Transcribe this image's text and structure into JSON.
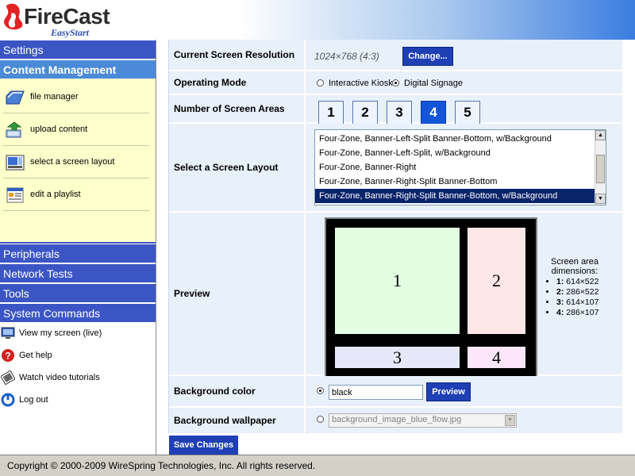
{
  "header": {
    "logo_title": "FireCast",
    "logo_subtitle": "EasyStart"
  },
  "sidebar": {
    "settings": "Settings",
    "content_management": "Content Management",
    "cm_items": [
      "file manager",
      "upload content",
      "select a screen layout",
      "edit a playlist"
    ],
    "peripherals": "Peripherals",
    "network_tests": "Network Tests",
    "tools": "Tools",
    "system_commands": "System Commands",
    "sys_items": [
      "View my screen (live)",
      "Get help",
      "Watch video tutorials",
      "Log out"
    ]
  },
  "form": {
    "resolution": {
      "label": "Current Screen Resolution",
      "value": "1024×768 (4:3)",
      "button": "Change..."
    },
    "mode": {
      "label": "Operating Mode",
      "options": [
        "Interactive Kiosk",
        "Digital Signage"
      ],
      "selected": 1
    },
    "areas": {
      "label": "Number of Screen Areas",
      "options": [
        "1",
        "2",
        "3",
        "4",
        "5"
      ],
      "selected": 3
    },
    "layout": {
      "label": "Select a Screen Layout",
      "items": [
        "Four-Zone, Banner-Left-Split Banner-Bottom, w/Background",
        "Four-Zone, Banner-Left-Split, w/Background",
        "Four-Zone, Banner-Right",
        "Four-Zone, Banner-Right-Split Banner-Bottom",
        "Four-Zone, Banner-Right-Split Banner-Bottom, w/Background"
      ],
      "selected": 4
    },
    "preview": {
      "label": "Preview",
      "zones": [
        "1",
        "2",
        "3",
        "4"
      ],
      "dims_title": "Screen area dimensions:",
      "dims": [
        {
          "key": "1:",
          "value": "614×522"
        },
        {
          "key": "2:",
          "value": "286×522"
        },
        {
          "key": "3:",
          "value": "614×107"
        },
        {
          "key": "4:",
          "value": "286×107"
        }
      ],
      "zone_colors": [
        "#e2fde2",
        "#fde6e6",
        "#e6e8fa",
        "#fbe6fa"
      ]
    },
    "bgcolor": {
      "label": "Background color",
      "value": "black",
      "button": "Preview"
    },
    "wallpaper": {
      "label": "Background wallpaper",
      "value": "background_image_blue_flow.jpg"
    },
    "save": "Save Changes"
  },
  "footer": {
    "copyright": "Copyright © 2000-2009 WireSpring Technologies, Inc. All rights reserved."
  },
  "colors": {
    "nav": "#3b56c4",
    "nav_active": "#4a8ad8",
    "accent": "#1f3fb5",
    "selected_area": "#1554d8"
  },
  "icons": [
    "folder-icon",
    "upload-icon",
    "layout-icon",
    "playlist-icon",
    "monitor-icon",
    "help-icon",
    "video-icon",
    "logout-icon"
  ]
}
